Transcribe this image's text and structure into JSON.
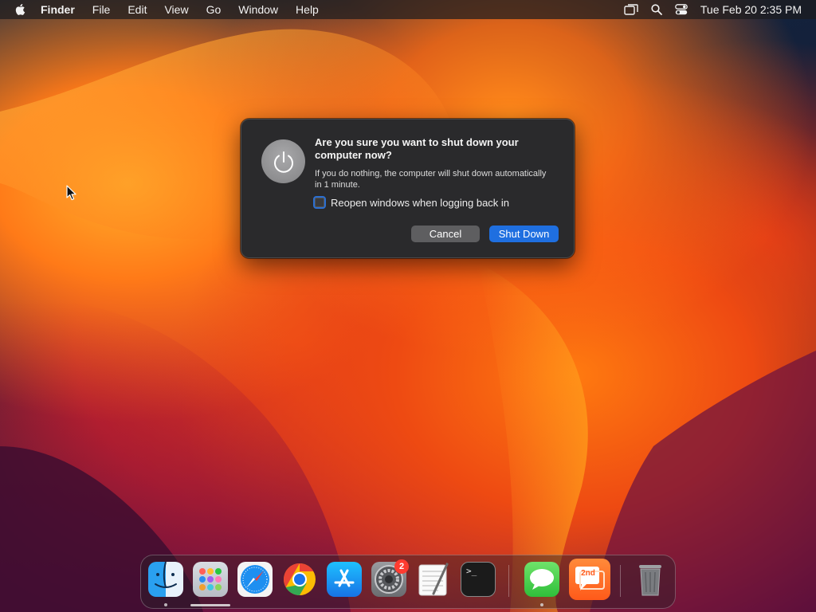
{
  "menubar": {
    "apple_icon": "apple-logo-icon",
    "app_name": "Finder",
    "menus": [
      "File",
      "Edit",
      "View",
      "Go",
      "Window",
      "Help"
    ],
    "status_icons": [
      "screen-mirroring-icon",
      "search-icon",
      "control-center-icon"
    ],
    "clock": "Tue Feb 20  2:35 PM"
  },
  "dialog": {
    "icon": "power-icon",
    "title": "Are you sure you want to shut down your computer now?",
    "message": "If you do nothing, the computer will shut down automatically in 1 minute.",
    "checkbox_label": "Reopen windows when logging back in",
    "checkbox_checked": false,
    "cancel_label": "Cancel",
    "confirm_label": "Shut Down",
    "accent_color": "#1f6fe0"
  },
  "dock": {
    "apps": [
      {
        "name": "Finder",
        "icon": "finder-icon",
        "running": true
      },
      {
        "name": "Launchpad",
        "icon": "launchpad-icon",
        "running": false
      },
      {
        "name": "Safari",
        "icon": "safari-icon",
        "running": false
      },
      {
        "name": "Google Chrome",
        "icon": "chrome-icon",
        "running": false
      },
      {
        "name": "App Store",
        "icon": "app-store-icon",
        "running": false
      },
      {
        "name": "System Settings",
        "icon": "system-settings-icon",
        "running": false,
        "badge": "2"
      },
      {
        "name": "TextEdit",
        "icon": "textedit-icon",
        "running": false
      },
      {
        "name": "Terminal",
        "icon": "terminal-icon",
        "running": false
      },
      {
        "name": "Messages",
        "icon": "messages-icon",
        "running": true
      },
      {
        "name": "2nd",
        "icon": "2nd-app-icon",
        "running": false,
        "label": "2nd"
      },
      {
        "name": "Trash",
        "icon": "trash-icon",
        "running": false
      }
    ],
    "terminal_prompt": ">_"
  }
}
